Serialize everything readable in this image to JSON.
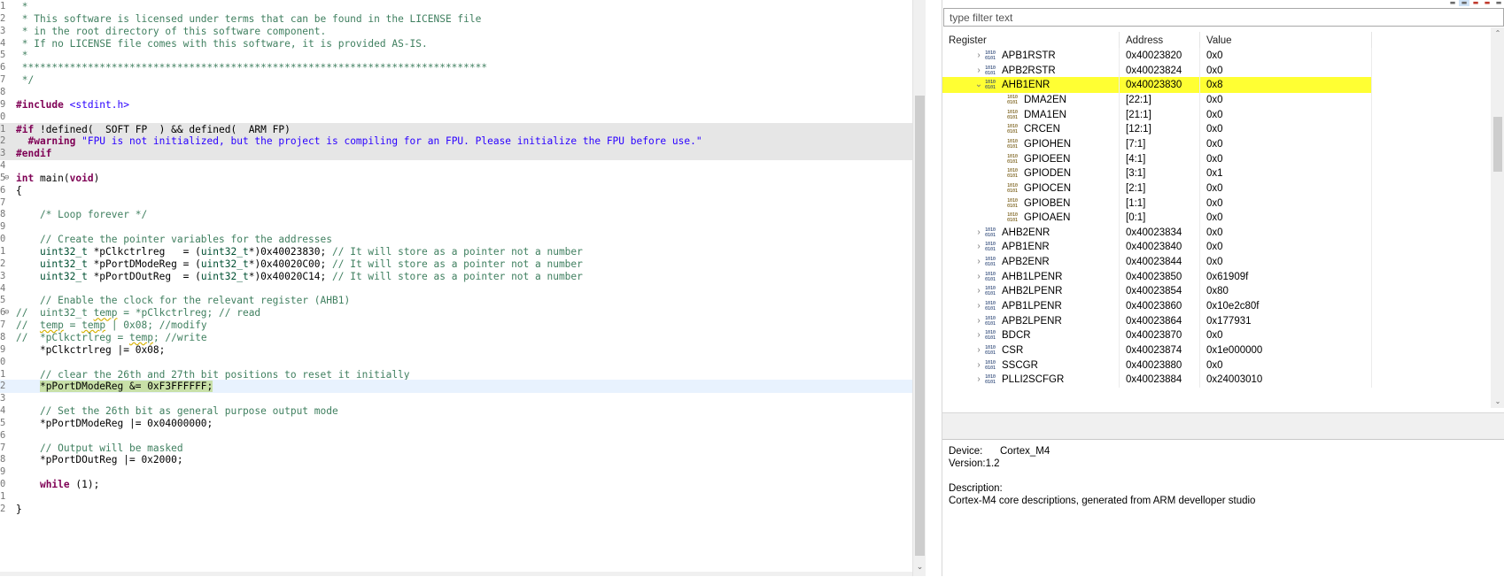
{
  "editor": {
    "lines": [
      {
        "n": "1",
        "fold": "",
        "style": "",
        "tokens": [
          {
            "t": " *",
            "c": "t-c"
          }
        ]
      },
      {
        "n": "2",
        "fold": "",
        "style": "",
        "tokens": [
          {
            "t": " * This software is licensed under terms that can be found in the LICENSE file",
            "c": "t-c"
          }
        ]
      },
      {
        "n": "3",
        "fold": "",
        "style": "",
        "tokens": [
          {
            "t": " * in the root directory of this software component.",
            "c": "t-c"
          }
        ]
      },
      {
        "n": "4",
        "fold": "",
        "style": "",
        "tokens": [
          {
            "t": " * If no LICENSE file comes with this software, it is provided AS-IS.",
            "c": "t-c"
          }
        ]
      },
      {
        "n": "5",
        "fold": "",
        "style": "",
        "tokens": [
          {
            "t": " *",
            "c": "t-c"
          }
        ]
      },
      {
        "n": "6",
        "fold": "",
        "style": "",
        "tokens": [
          {
            "t": " ******************************************************************************",
            "c": "t-c"
          }
        ]
      },
      {
        "n": "7",
        "fold": "",
        "style": "",
        "tokens": [
          {
            "t": " */",
            "c": "t-c"
          }
        ]
      },
      {
        "n": "8",
        "fold": "",
        "style": "",
        "tokens": []
      },
      {
        "n": "9",
        "fold": "",
        "style": "",
        "tokens": [
          {
            "t": "#include ",
            "c": "t-pp"
          },
          {
            "t": "<stdint.h>",
            "c": "t-inc"
          }
        ]
      },
      {
        "n": "0",
        "fold": "",
        "style": "",
        "tokens": []
      },
      {
        "n": "1",
        "fold": "",
        "style": "inactive",
        "tokens": [
          {
            "t": "#if ",
            "c": "t-pp"
          },
          {
            "t": "!defined(__SOFT_FP__) && defined(__ARM_FP)",
            "c": ""
          }
        ]
      },
      {
        "n": "2",
        "fold": "",
        "style": "inactive",
        "tokens": [
          {
            "t": "  #warning ",
            "c": "t-pp"
          },
          {
            "t": "\"FPU is not initialized, but the project is compiling for an FPU. Please initialize the FPU before use.\"",
            "c": "t-str"
          }
        ]
      },
      {
        "n": "3",
        "fold": "",
        "style": "inactive",
        "tokens": [
          {
            "t": "#endif",
            "c": "t-pp"
          }
        ]
      },
      {
        "n": "4",
        "fold": "",
        "style": "",
        "tokens": []
      },
      {
        "n": "5",
        "fold": "⊖",
        "style": "",
        "tokens": [
          {
            "t": "int ",
            "c": "t-kw"
          },
          {
            "t": "main(",
            "c": ""
          },
          {
            "t": "void",
            "c": "t-kw"
          },
          {
            "t": ")",
            "c": ""
          }
        ]
      },
      {
        "n": "6",
        "fold": "",
        "style": "",
        "tokens": [
          {
            "t": "{",
            "c": ""
          }
        ]
      },
      {
        "n": "7",
        "fold": "",
        "style": "",
        "tokens": []
      },
      {
        "n": "8",
        "fold": "",
        "style": "",
        "tokens": [
          {
            "t": "    /* Loop forever */",
            "c": "t-c"
          }
        ]
      },
      {
        "n": "9",
        "fold": "",
        "style": "",
        "tokens": []
      },
      {
        "n": "0",
        "fold": "",
        "style": "",
        "tokens": [
          {
            "t": "    // Create the pointer variables for the addresses",
            "c": "t-c"
          }
        ]
      },
      {
        "n": "1",
        "fold": "",
        "style": "",
        "tokens": [
          {
            "t": "    uint32_t ",
            "c": "t-ty"
          },
          {
            "t": "*pClkctrlreg   = (",
            "c": ""
          },
          {
            "t": "uint32_t",
            "c": "t-ty"
          },
          {
            "t": "*)0x40023830; ",
            "c": ""
          },
          {
            "t": "// It will store as a pointer not a number",
            "c": "t-c"
          }
        ]
      },
      {
        "n": "2",
        "fold": "",
        "style": "",
        "tokens": [
          {
            "t": "    uint32_t ",
            "c": "t-ty"
          },
          {
            "t": "*pPortDModeReg = (",
            "c": ""
          },
          {
            "t": "uint32_t",
            "c": "t-ty"
          },
          {
            "t": "*)0x40020C00; ",
            "c": ""
          },
          {
            "t": "// It will store as a pointer not a number",
            "c": "t-c"
          }
        ]
      },
      {
        "n": "3",
        "fold": "",
        "style": "",
        "tokens": [
          {
            "t": "    uint32_t ",
            "c": "t-ty"
          },
          {
            "t": "*pPortDOutReg  = (",
            "c": ""
          },
          {
            "t": "uint32_t",
            "c": "t-ty"
          },
          {
            "t": "*)0x40020C14; ",
            "c": ""
          },
          {
            "t": "// It will store as a pointer not a number",
            "c": "t-c"
          }
        ]
      },
      {
        "n": "4",
        "fold": "",
        "style": "",
        "tokens": []
      },
      {
        "n": "5",
        "fold": "",
        "style": "",
        "tokens": [
          {
            "t": "    // Enable the clock for the relevant register (AHB1)",
            "c": "t-c"
          }
        ]
      },
      {
        "n": "6",
        "fold": "⊖",
        "style": "",
        "tokens": [
          {
            "t": "//  uint32_t ",
            "c": "t-c"
          },
          {
            "t": "temp",
            "c": "t-c t-sq"
          },
          {
            "t": " = *pClkctrlreg; // read",
            "c": "t-c"
          }
        ]
      },
      {
        "n": "7",
        "fold": "",
        "style": "",
        "tokens": [
          {
            "t": "//  ",
            "c": "t-c"
          },
          {
            "t": "temp",
            "c": "t-c t-sq"
          },
          {
            "t": " = ",
            "c": "t-c"
          },
          {
            "t": "temp",
            "c": "t-c t-sq"
          },
          {
            "t": " | 0x08; //modify",
            "c": "t-c"
          }
        ]
      },
      {
        "n": "8",
        "fold": "",
        "style": "",
        "tokens": [
          {
            "t": "//  *pClkctrlreg = ",
            "c": "t-c"
          },
          {
            "t": "temp",
            "c": "t-c t-sq"
          },
          {
            "t": "; //write",
            "c": "t-c"
          }
        ]
      },
      {
        "n": "9",
        "fold": "",
        "style": "",
        "tokens": [
          {
            "t": "    *pClkctrlreg |= 0x08;",
            "c": ""
          }
        ]
      },
      {
        "n": "0",
        "fold": "",
        "style": "",
        "tokens": []
      },
      {
        "n": "1",
        "fold": "",
        "style": "",
        "tokens": [
          {
            "t": "    // clear the 26th and 27th bit positions to reset it initially",
            "c": "t-c"
          }
        ]
      },
      {
        "n": "2",
        "fold": "",
        "style": "current",
        "tokens": [
          {
            "t": "    ",
            "c": ""
          },
          {
            "t": "*pPortDModeReg &= 0xF3FFFFFF;",
            "c": "sel"
          }
        ]
      },
      {
        "n": "3",
        "fold": "",
        "style": "",
        "tokens": []
      },
      {
        "n": "4",
        "fold": "",
        "style": "",
        "tokens": [
          {
            "t": "    // Set the 26th bit as general purpose output mode",
            "c": "t-c"
          }
        ]
      },
      {
        "n": "5",
        "fold": "",
        "style": "",
        "tokens": [
          {
            "t": "    *pPortDModeReg |= 0x04000000;",
            "c": ""
          }
        ]
      },
      {
        "n": "6",
        "fold": "",
        "style": "",
        "tokens": []
      },
      {
        "n": "7",
        "fold": "",
        "style": "",
        "tokens": [
          {
            "t": "    // Output will be masked",
            "c": "t-c"
          }
        ]
      },
      {
        "n": "8",
        "fold": "",
        "style": "",
        "tokens": [
          {
            "t": "    *pPortDOutReg |= 0x2000;",
            "c": ""
          }
        ]
      },
      {
        "n": "9",
        "fold": "",
        "style": "",
        "tokens": []
      },
      {
        "n": "0",
        "fold": "",
        "style": "",
        "tokens": [
          {
            "t": "    ",
            "c": ""
          },
          {
            "t": "while",
            "c": "t-kw"
          },
          {
            "t": " (1);",
            "c": ""
          }
        ]
      },
      {
        "n": "1",
        "fold": "",
        "style": "",
        "tokens": []
      },
      {
        "n": "2",
        "fold": "",
        "style": "",
        "tokens": [
          {
            "t": "}",
            "c": ""
          }
        ]
      }
    ]
  },
  "registers": {
    "filter_placeholder": "type filter text",
    "columns": {
      "register": "Register",
      "address": "Address",
      "value": "Value"
    },
    "rows": [
      {
        "name": "APB1RSTR",
        "addr": "0x40023820",
        "val": "0x0",
        "level": 1,
        "twisty": "›",
        "hl": false
      },
      {
        "name": "APB2RSTR",
        "addr": "0x40023824",
        "val": "0x0",
        "level": 1,
        "twisty": "›",
        "hl": false
      },
      {
        "name": "AHB1ENR",
        "addr": "0x40023830",
        "val": "0x8",
        "level": 1,
        "twisty": "⌄",
        "hl": true
      },
      {
        "name": "DMA2EN",
        "addr": "[22:1]",
        "val": "0x0",
        "level": 2,
        "twisty": "",
        "hl": false
      },
      {
        "name": "DMA1EN",
        "addr": "[21:1]",
        "val": "0x0",
        "level": 2,
        "twisty": "",
        "hl": false
      },
      {
        "name": "CRCEN",
        "addr": "[12:1]",
        "val": "0x0",
        "level": 2,
        "twisty": "",
        "hl": false
      },
      {
        "name": "GPIOHEN",
        "addr": "[7:1]",
        "val": "0x0",
        "level": 2,
        "twisty": "",
        "hl": false
      },
      {
        "name": "GPIOEEN",
        "addr": "[4:1]",
        "val": "0x0",
        "level": 2,
        "twisty": "",
        "hl": false
      },
      {
        "name": "GPIODEN",
        "addr": "[3:1]",
        "val": "0x1",
        "level": 2,
        "twisty": "",
        "hl": false
      },
      {
        "name": "GPIOCEN",
        "addr": "[2:1]",
        "val": "0x0",
        "level": 2,
        "twisty": "",
        "hl": false
      },
      {
        "name": "GPIOBEN",
        "addr": "[1:1]",
        "val": "0x0",
        "level": 2,
        "twisty": "",
        "hl": false
      },
      {
        "name": "GPIOAEN",
        "addr": "[0:1]",
        "val": "0x0",
        "level": 2,
        "twisty": "",
        "hl": false
      },
      {
        "name": "AHB2ENR",
        "addr": "0x40023834",
        "val": "0x0",
        "level": 1,
        "twisty": "›",
        "hl": false
      },
      {
        "name": "APB1ENR",
        "addr": "0x40023840",
        "val": "0x0",
        "level": 1,
        "twisty": "›",
        "hl": false
      },
      {
        "name": "APB2ENR",
        "addr": "0x40023844",
        "val": "0x0",
        "level": 1,
        "twisty": "›",
        "hl": false
      },
      {
        "name": "AHB1LPENR",
        "addr": "0x40023850",
        "val": "0x61909f",
        "level": 1,
        "twisty": "›",
        "hl": false
      },
      {
        "name": "AHB2LPENR",
        "addr": "0x40023854",
        "val": "0x80",
        "level": 1,
        "twisty": "›",
        "hl": false
      },
      {
        "name": "APB1LPENR",
        "addr": "0x40023860",
        "val": "0x10e2c80f",
        "level": 1,
        "twisty": "›",
        "hl": false
      },
      {
        "name": "APB2LPENR",
        "addr": "0x40023864",
        "val": "0x177931",
        "level": 1,
        "twisty": "›",
        "hl": false
      },
      {
        "name": "BDCR",
        "addr": "0x40023870",
        "val": "0x0",
        "level": 1,
        "twisty": "›",
        "hl": false
      },
      {
        "name": "CSR",
        "addr": "0x40023874",
        "val": "0x1e000000",
        "level": 1,
        "twisty": "›",
        "hl": false
      },
      {
        "name": "SSCGR",
        "addr": "0x40023880",
        "val": "0x0",
        "level": 1,
        "twisty": "›",
        "hl": false
      },
      {
        "name": "PLLI2SCFGR",
        "addr": "0x40023884",
        "val": "0x24003010",
        "level": 1,
        "twisty": "›",
        "hl": false
      }
    ]
  },
  "details": {
    "device_label": "Device:",
    "device_value": "Cortex_M4",
    "version_label": "Version:",
    "version_value": "1.2",
    "description_label": "Description:",
    "description_value": "Cortex-M4 core descriptions, generated from ARM develloper studio"
  },
  "colors": {
    "selected_row": "#ffff33",
    "comment": "#3f7f5f",
    "keyword": "#7f0055",
    "string": "#2a00ff"
  }
}
